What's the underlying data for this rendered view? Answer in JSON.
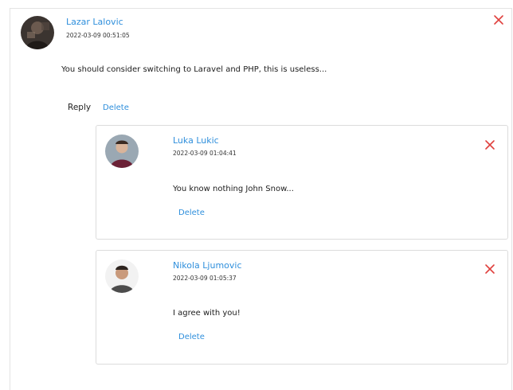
{
  "main_comment": {
    "author": "Lazar Lalovic",
    "timestamp": "2022-03-09 00:51:05",
    "text": "You should consider switching to Laravel and PHP, this is useless...",
    "reply_label": "Reply",
    "delete_label": "Delete",
    "close_icon": "close-icon"
  },
  "replies": [
    {
      "author": "Luka Lukic",
      "timestamp": "2022-03-09 01:04:41",
      "text": "You know nothing John Snow...",
      "delete_label": "Delete"
    },
    {
      "author": "Nikola Ljumovic",
      "timestamp": "2022-03-09 01:05:37",
      "text": "I agree with you!",
      "delete_label": "Delete"
    }
  ],
  "colors": {
    "link": "#2f8fdc",
    "close": "#e0413e",
    "border": "#dcdcdc"
  }
}
